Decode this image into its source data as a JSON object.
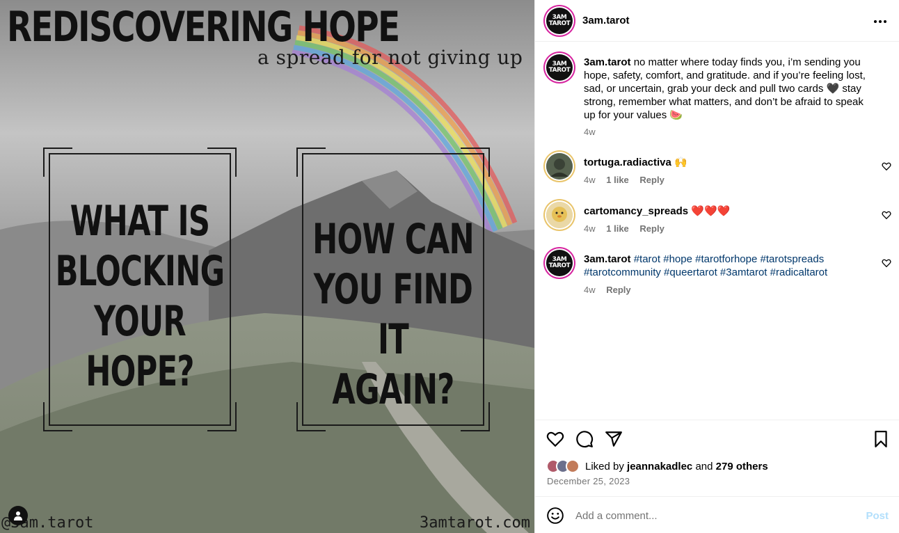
{
  "image": {
    "title": "REDISCOVERING HOPE",
    "subtitle": "a spread for not giving up",
    "card1": "WHAT IS\nBLOCKING\nYOUR\nHOPE?",
    "card2": "HOW CAN\nYOU FIND IT\nAGAIN?",
    "handle": "@3am.tarot",
    "site": "3amtarot.com"
  },
  "header": {
    "avatar_text": "3AM\nTAROT",
    "username": "3am.tarot",
    "more_icon": "more-horizontal-icon"
  },
  "caption": {
    "username": "3am.tarot",
    "text": "no matter where today finds you, i’m sending you hope, safety, comfort, and gratitude. and if you’re feeling lost, sad, or uncertain, grab your deck and pull two cards 🖤 stay strong, remember what matters, and don’t be afraid to speak up for your values 🍉",
    "time": "4w"
  },
  "comments": [
    {
      "username": "tortuga.radiactiva",
      "text": "🙌",
      "time": "4w",
      "likes": "1 like",
      "reply": "Reply"
    },
    {
      "username": "cartomancy_spreads",
      "text": "❤️❤️❤️",
      "time": "4w",
      "likes": "1 like",
      "reply": "Reply"
    },
    {
      "username": "3am.tarot",
      "text": "#tarot #hope #tarotforhope #tarotspreads #tarotcommunity #queertarot #3amtarot #radicaltarot",
      "time": "4w",
      "reply": "Reply"
    }
  ],
  "actions": {
    "liked_prefix": "Liked by",
    "liked_user": "jeannakadlec",
    "liked_and": "and",
    "liked_others": "279 others",
    "date": "December 25, 2023"
  },
  "add_comment": {
    "placeholder": "Add a comment...",
    "post_label": "Post"
  },
  "colors": {
    "link": "#00376b",
    "muted": "#737373",
    "post_disabled": "#b2dffc",
    "story_ring": "#d6249f"
  }
}
